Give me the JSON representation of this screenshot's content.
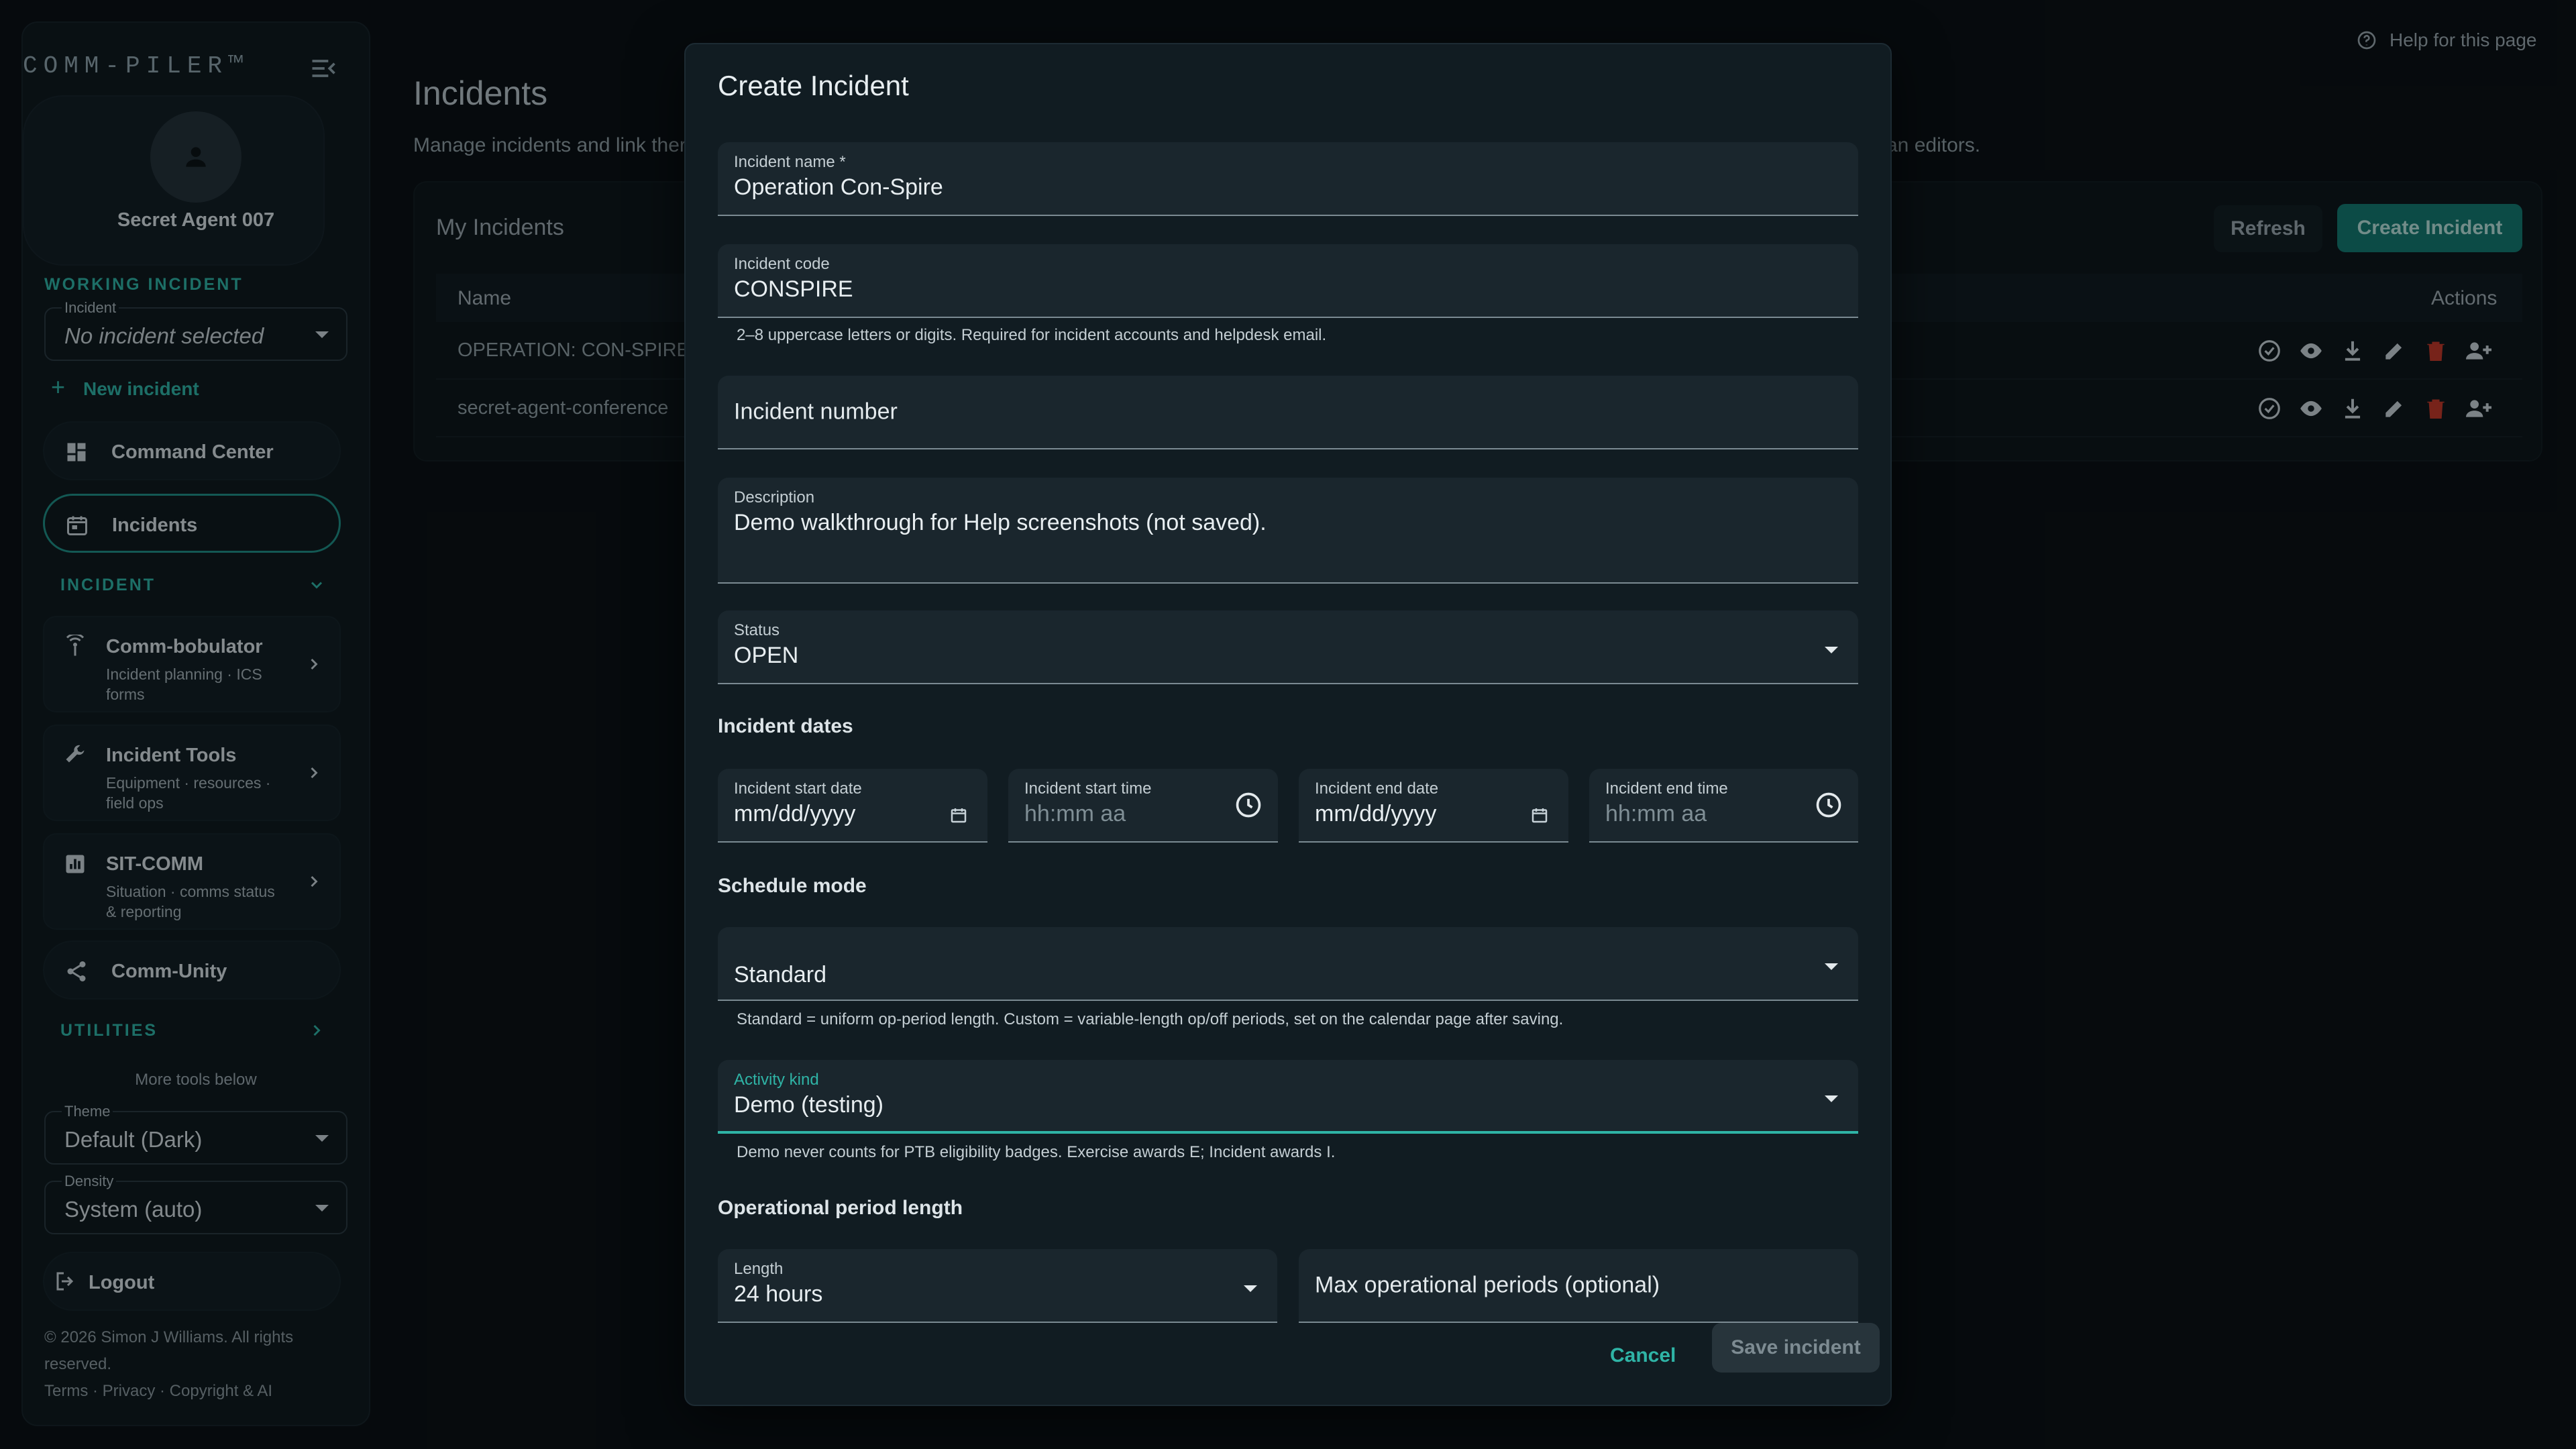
{
  "sidebar": {
    "brand": "COMM-PILER™",
    "profile_name": "Secret Agent 007",
    "working_incident_label": "WORKING INCIDENT",
    "incident_select": {
      "label": "Incident",
      "value": "No incident selected"
    },
    "new_incident": "New incident",
    "nav_command_center": "Command Center",
    "nav_incidents": "Incidents",
    "incident_section": "INCIDENT",
    "cards": [
      {
        "title": "Comm-bobulator",
        "subtitle": "Incident planning · ICS forms",
        "icon": "antenna-icon"
      },
      {
        "title": "Incident Tools",
        "subtitle": "Equipment · resources · field ops",
        "icon": "wrench-icon"
      },
      {
        "title": "SIT-COMM",
        "subtitle": "Situation · comms status & reporting",
        "icon": "chart-icon"
      }
    ],
    "nav_comm_unity": "Comm-Unity",
    "utilities": "UTILITIES",
    "more_tools": "More tools below",
    "theme": {
      "label": "Theme",
      "value": "Default (Dark)"
    },
    "density": {
      "label": "Density",
      "value": "System (auto)"
    },
    "logout": "Logout",
    "copyright": "© 2026 Simon J Williams. All rights reserved.",
    "footer_links": "Terms · Privacy · Copyright & AI"
  },
  "main": {
    "title": "Incidents",
    "description_start": "Manage incidents and link ther",
    "description_end": "an editors.",
    "help": "Help for this page",
    "card_title": "My Incidents",
    "refresh": "Refresh",
    "create": "Create Incident",
    "columns": {
      "name": "Name",
      "actions": "Actions"
    },
    "rows": [
      {
        "name": "OPERATION: CON-SPIRE"
      },
      {
        "name": "secret-agent-conference"
      }
    ]
  },
  "modal": {
    "title": "Create Incident",
    "incident_name": {
      "label": "Incident name *",
      "value": "Operation Con-Spire"
    },
    "incident_code": {
      "label": "Incident code",
      "value": "CONSPIRE",
      "helper": "2–8 uppercase letters or digits. Required for incident accounts and helpdesk email."
    },
    "incident_number": {
      "placeholder": "Incident number"
    },
    "description": {
      "label": "Description",
      "value": "Demo walkthrough for Help screenshots (not saved)."
    },
    "status": {
      "label": "Status",
      "value": "OPEN"
    },
    "dates_heading": "Incident dates",
    "start_date": {
      "label": "Incident start date",
      "placeholder": "mm/dd/yyyy"
    },
    "start_time": {
      "label": "Incident start time",
      "placeholder": "hh:mm aa"
    },
    "end_date": {
      "label": "Incident end date",
      "placeholder": "mm/dd/yyyy"
    },
    "end_time": {
      "label": "Incident end time",
      "placeholder": "hh:mm aa"
    },
    "schedule_heading": "Schedule mode",
    "schedule": {
      "value": "Standard",
      "helper": "Standard = uniform op-period length. Custom = variable-length op/off periods, set on the calendar page after saving."
    },
    "activity": {
      "label": "Activity kind",
      "value": "Demo (testing)",
      "helper": "Demo never counts for PTB eligibility badges. Exercise awards E; Incident awards I."
    },
    "op_heading": "Operational period length",
    "length": {
      "label": "Length",
      "value": "24 hours"
    },
    "max_periods": {
      "placeholder": "Max operational periods (optional)"
    },
    "cancel": "Cancel",
    "save": "Save incident"
  },
  "colors": {
    "accent": "#2fb4a6",
    "background": "#0b1115",
    "danger": "#c0392b"
  }
}
